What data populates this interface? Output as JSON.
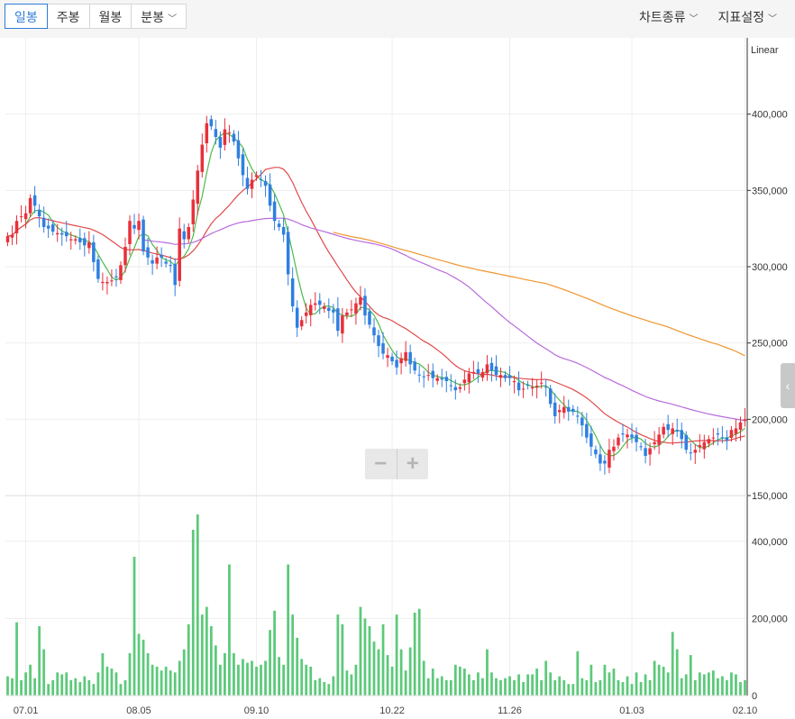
{
  "toolbar": {
    "tabs": [
      "일봉",
      "주봉",
      "월봉",
      "분봉"
    ],
    "active_tab": 0,
    "chart_type_menu": "차트종류",
    "indicator_menu": "지표설정"
  },
  "zoom": {
    "minus": "−",
    "plus": "+"
  },
  "colors": {
    "up": "#e8303b",
    "down": "#2f7fe0",
    "volume": "#5cc97a",
    "ma5": "#4dbb4d",
    "ma20": "#e04a4a",
    "ma60": "#b76bdc",
    "ma120": "#f0962f",
    "grid": "#eeeeee",
    "axis": "#333333"
  },
  "chart_data": [
    {
      "type": "candlestick",
      "scale": "Linear",
      "ylim": [
        150000,
        450000
      ],
      "yticks": [
        150000,
        200000,
        250000,
        300000,
        350000,
        400000
      ],
      "ytick_labels": [
        "150,000",
        "200,000",
        "250,000",
        "300,000",
        "350,000",
        "400,000"
      ],
      "x_tick_labels": [
        "07.01",
        "08.05",
        "09.10",
        "10.22",
        "11.26",
        "01.03",
        "02.10"
      ],
      "close": [
        320000,
        321000,
        330000,
        333000,
        335000,
        345000,
        340000,
        333000,
        326000,
        325000,
        323000,
        322000,
        321000,
        320000,
        318000,
        318000,
        316000,
        314000,
        316000,
        303000,
        292000,
        290000,
        290000,
        291000,
        293000,
        301000,
        313000,
        330000,
        325000,
        330000,
        310000,
        306000,
        302000,
        306000,
        306000,
        302000,
        301000,
        288000,
        325000,
        318000,
        326000,
        344000,
        363000,
        380000,
        394000,
        392000,
        385000,
        378000,
        390000,
        388000,
        382000,
        371000,
        360000,
        351000,
        357000,
        360000,
        357000,
        353000,
        340000,
        330000,
        326000,
        321000,
        295000,
        274000,
        260000,
        265000,
        270000,
        275000,
        276000,
        275000,
        274000,
        271000,
        270000,
        258000,
        268000,
        270000,
        272000,
        276000,
        280000,
        268000,
        262000,
        255000,
        248000,
        243000,
        242000,
        238000,
        234000,
        240000,
        244000,
        236000,
        232000,
        229000,
        228000,
        229000,
        227000,
        227000,
        226000,
        225000,
        222000,
        219000,
        221000,
        226000,
        230000,
        231000,
        230000,
        231000,
        236000,
        232000,
        229000,
        229000,
        227000,
        227000,
        225000,
        219000,
        220000,
        222000,
        221000,
        222000,
        224000,
        221000,
        210000,
        202000,
        206000,
        208000,
        205000,
        205000,
        202000,
        196000,
        188000,
        182000,
        177000,
        171000,
        171000,
        180000,
        182000,
        188000,
        190000,
        190000,
        188000,
        185000,
        182000,
        176000,
        181000,
        185000,
        190000,
        195000,
        193000,
        194000,
        192000,
        187000,
        180000,
        178000,
        180000,
        183000,
        185000,
        187000,
        188000,
        190000,
        188000,
        186000,
        193000,
        194000,
        198000,
        200000
      ],
      "volume": [
        50000,
        45000,
        190000,
        40000,
        60000,
        80000,
        45000,
        180000,
        120000,
        30000,
        40000,
        60000,
        55000,
        60000,
        40000,
        45000,
        35000,
        50000,
        40000,
        30000,
        60000,
        110000,
        75000,
        70000,
        60000,
        30000,
        40000,
        110000,
        360000,
        160000,
        145000,
        110000,
        80000,
        75000,
        65000,
        75000,
        65000,
        60000,
        90000,
        120000,
        185000,
        430000,
        470000,
        210000,
        230000,
        180000,
        130000,
        80000,
        110000,
        340000,
        110000,
        80000,
        95000,
        85000,
        90000,
        75000,
        80000,
        90000,
        170000,
        220000,
        100000,
        80000,
        340000,
        210000,
        150000,
        95000,
        80000,
        75000,
        40000,
        45000,
        35000,
        30000,
        50000,
        210000,
        185000,
        65000,
        55000,
        80000,
        230000,
        200000,
        180000,
        140000,
        120000,
        185000,
        105000,
        75000,
        210000,
        120000,
        65000,
        125000,
        215000,
        225000,
        90000,
        45000,
        70000,
        45000,
        50000,
        40000,
        40000,
        80000,
        75000,
        70000,
        55000,
        40000,
        60000,
        45000,
        120000,
        60000,
        45000,
        40000,
        45000,
        50000,
        40000,
        55000,
        35000,
        55000,
        55000,
        70000,
        40000,
        90000,
        60000,
        40000,
        50000,
        40000,
        30000,
        30000,
        115000,
        45000,
        40000,
        80000,
        35000,
        40000,
        80000,
        60000,
        70000,
        40000,
        35000,
        50000,
        30000,
        60000,
        35000,
        55000,
        40000,
        90000,
        80000,
        75000,
        60000,
        165000,
        120000,
        45000,
        55000,
        105000,
        40000,
        60000,
        55000,
        60000,
        65000,
        45000,
        50000,
        40000,
        60000,
        55000,
        35000,
        40000,
        60000,
        55000
      ],
      "ma5_start": 0,
      "ma20_start": 0,
      "ma60_start": 30,
      "ma120_start": 72
    }
  ],
  "volume_axis": {
    "ylim": [
      0,
      500000
    ],
    "yticks": [
      0,
      200000,
      400000
    ],
    "ytick_labels": [
      "0",
      "200,000",
      "400,000"
    ]
  }
}
